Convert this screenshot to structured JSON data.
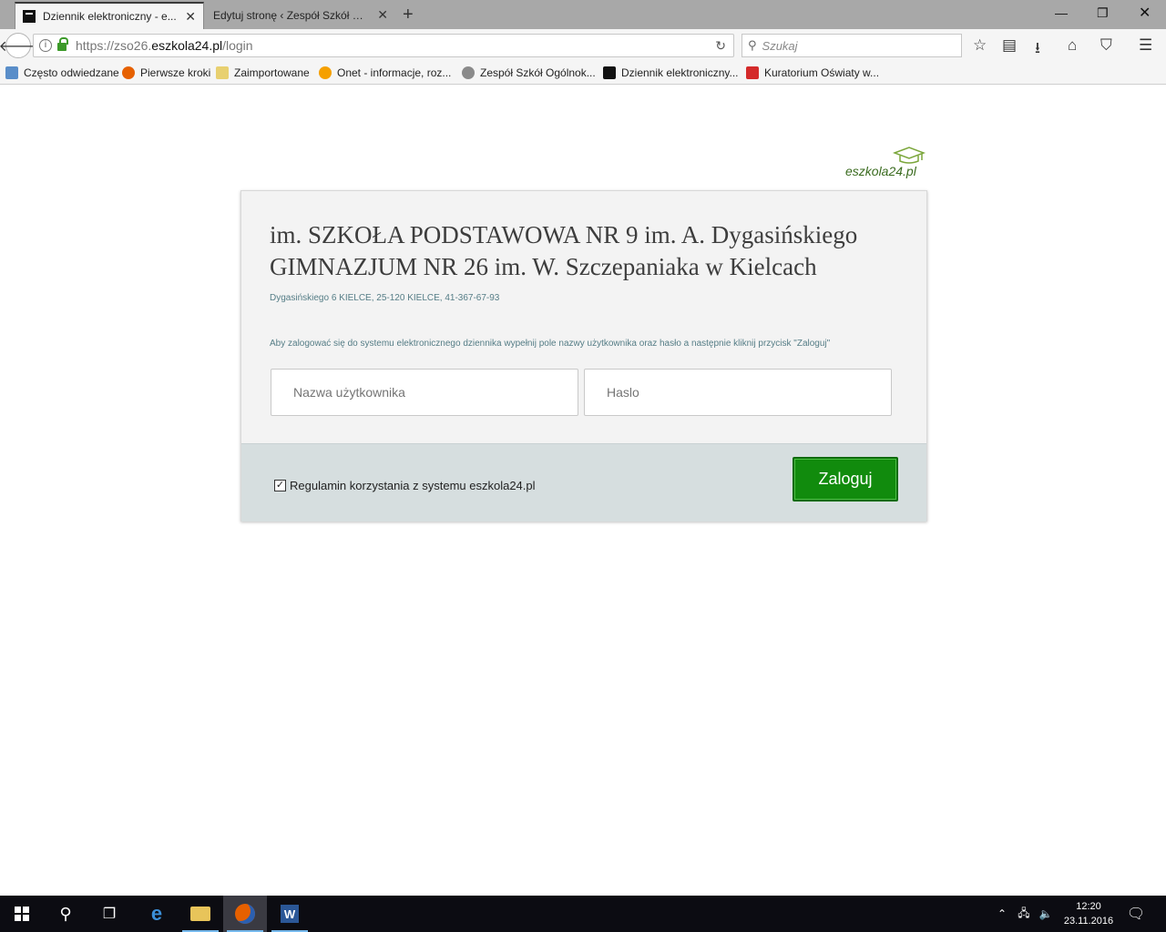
{
  "browser": {
    "tabs": [
      {
        "title": "Dziennik elektroniczny - e..."
      },
      {
        "title": "Edytuj stronę ‹ Zespół Szkół O..."
      }
    ],
    "url_prefix": "https://zso26.",
    "url_domain": "eszkola24.pl",
    "url_path": "/login",
    "search_placeholder": "Szukaj",
    "bookmarks": [
      {
        "label": "Często odwiedzane"
      },
      {
        "label": "Pierwsze kroki"
      },
      {
        "label": "Zaimportowane"
      },
      {
        "label": "Onet - informacje, roz..."
      },
      {
        "label": "Zespół Szkół Ogólnok..."
      },
      {
        "label": "Dziennik elektroniczny..."
      },
      {
        "label": "Kuratorium Oświaty w..."
      }
    ]
  },
  "page": {
    "logo_text": "eszkola24.pl",
    "school_line1": "im. SZKOŁA PODSTAWOWA NR 9 im. A. Dygasińskiego",
    "school_line2": "GIMNAZJUM NR 26 im. W. Szczepaniaka w Kielcach",
    "address": "Dygasińskiego 6 KIELCE, 25-120 KIELCE, 41-367-67-93",
    "instructions": "Aby zalogować się do systemu elektronicznego dziennika wypełnij pole nazwy użytkownika oraz hasło a następnie kliknij przycisk \"Zaloguj\"",
    "username_placeholder": "Nazwa użytkownika",
    "password_placeholder": "Haslo",
    "terms_label": "Regulamin korzystania z systemu eszkola24.pl",
    "terms_checked": true,
    "login_label": "Zaloguj"
  },
  "taskbar": {
    "time": "12:20",
    "date": "23.11.2016"
  },
  "colors": {
    "login_button": "#118b0d",
    "footer_bg": "#d6dedf",
    "muted_text": "#557d86"
  }
}
